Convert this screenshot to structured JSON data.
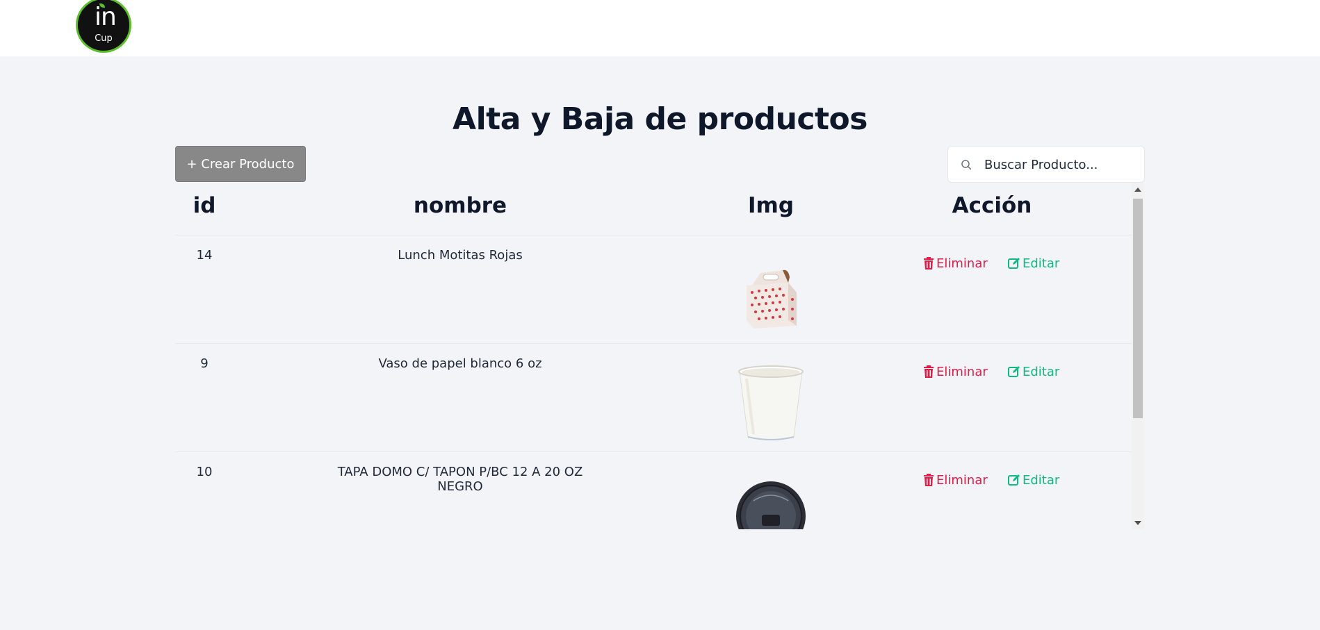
{
  "header": {
    "logo": {
      "main": "in",
      "sub": "Cup"
    }
  },
  "page": {
    "title": "Alta y Baja de productos",
    "create_button": "+ Crear Producto",
    "search_placeholder": "Buscar Producto..."
  },
  "table": {
    "columns": [
      "id",
      "nombre",
      "Img",
      "Acción"
    ],
    "rows": [
      {
        "id": "14",
        "nombre": "Lunch Motitas Rojas",
        "img": "red-polka-dot-lunch-box",
        "delete": "Eliminar",
        "edit": "Editar"
      },
      {
        "id": "9",
        "nombre": "Vaso de papel blanco 6 oz",
        "img": "white-paper-cup",
        "delete": "Eliminar",
        "edit": "Editar"
      },
      {
        "id": "10",
        "nombre": "TAPA DOMO C/ TAPON P/BC 12 A 20 OZ NEGRO",
        "img": "black-dome-lid",
        "delete": "Eliminar",
        "edit": "Editar"
      }
    ]
  },
  "colors": {
    "accent_green": "#5cbf2a",
    "delete_red": "#e11d48",
    "edit_green": "#10b981",
    "create_button_bg": "#888888"
  }
}
